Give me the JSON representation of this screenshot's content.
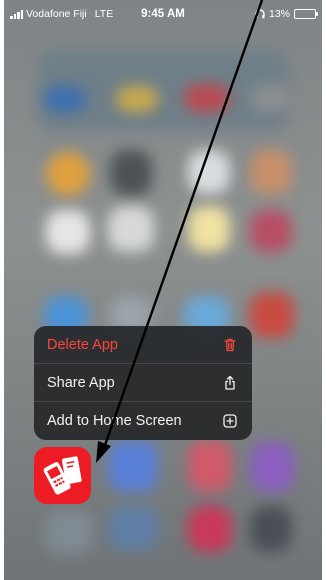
{
  "status_bar": {
    "carrier": "Vodafone Fiji",
    "network": "LTE",
    "time": "9:45 AM",
    "battery_percent": "13%",
    "battery_level": 0.13,
    "battery_color": "#ffd400"
  },
  "context_menu": {
    "items": [
      {
        "label": "Delete App",
        "icon": "trash-icon",
        "color": "#ff453a"
      },
      {
        "label": "Share App",
        "icon": "share-icon"
      },
      {
        "label": "Add to Home Screen",
        "icon": "add-square-icon"
      }
    ]
  },
  "app": {
    "icon": "vodafone-mpaisa-app-icon",
    "color": "#ed1c24"
  },
  "annotation": {
    "icon": "arrow-pointer-icon",
    "color": "#000000"
  }
}
